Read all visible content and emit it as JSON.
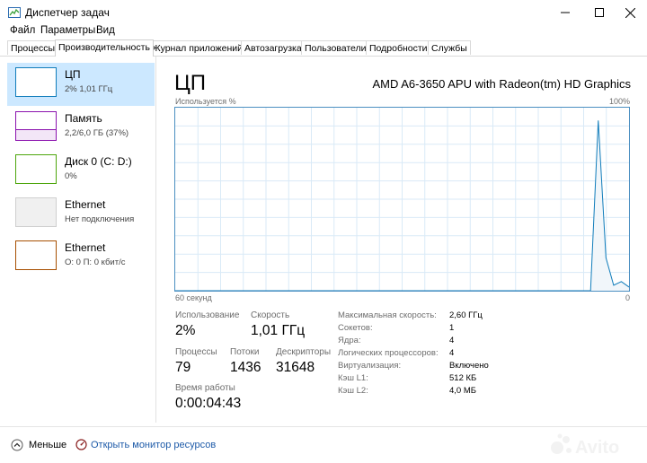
{
  "window": {
    "title": "Диспетчер задач",
    "icon": "task-manager-icon"
  },
  "menu": [
    "Файл",
    "Параметры",
    "Вид"
  ],
  "tabs": [
    "Процессы",
    "Производительность",
    "Журнал приложений",
    "Автозагрузка",
    "Пользователи",
    "Подробности",
    "Службы"
  ],
  "sidebar": {
    "items": [
      {
        "name": "ЦП",
        "value": "2% 1,01 ГГц",
        "color": "#117dbb"
      },
      {
        "name": "Память",
        "value": "2,2/6,0 ГБ (37%)",
        "color": "#8b12ae"
      },
      {
        "name": "Диск 0 (C: D:)",
        "value": "0%",
        "color": "#4da60c"
      },
      {
        "name": "Ethernet",
        "value": "Нет подключения",
        "color": "#cfcfcf"
      },
      {
        "name": "Ethernet",
        "value": "О: 0 П: 0 кбит/с",
        "color": "#a74f01"
      }
    ]
  },
  "main": {
    "title": "ЦП",
    "cpu_name": "AMD A6-3650 APU with Radeon(tm) HD Graphics",
    "graph": {
      "label_top_left": "Используется %",
      "label_top_right": "100%",
      "label_bottom_left": "60 секунд",
      "label_bottom_right": "0",
      "line_color": "#117dbb",
      "usage_history": [
        0,
        0,
        0,
        0,
        0,
        0,
        0,
        0,
        0,
        0,
        0,
        0,
        0,
        0,
        0,
        0,
        0,
        0,
        0,
        0,
        0,
        0,
        0,
        0,
        0,
        0,
        0,
        0,
        0,
        0,
        0,
        0,
        0,
        0,
        0,
        0,
        0,
        0,
        0,
        0,
        0,
        0,
        0,
        0,
        0,
        0,
        0,
        0,
        0,
        0,
        0,
        0,
        0,
        0,
        0,
        93,
        18,
        3,
        5,
        2
      ]
    },
    "stats": {
      "usage_label": "Использование",
      "usage_value": "2%",
      "speed_label": "Скорость",
      "speed_value": "1,01 ГГц",
      "processes_label": "Процессы",
      "processes_value": "79",
      "threads_label": "Потоки",
      "threads_value": "1436",
      "handles_label": "Дескрипторы",
      "handles_value": "31648",
      "uptime_label": "Время работы",
      "uptime_value": "0:00:04:43"
    },
    "details": [
      {
        "label": "Максимальная скорость:",
        "value": "2,60 ГГц"
      },
      {
        "label": "Сокетов:",
        "value": "1"
      },
      {
        "label": "Ядра:",
        "value": "4"
      },
      {
        "label": "Логических процессоров:",
        "value": "4"
      },
      {
        "label": "Виртуализация:",
        "value": "Включено"
      },
      {
        "label": "Кэш L1:",
        "value": "512 КБ"
      },
      {
        "label": "Кэш L2:",
        "value": "4,0 МБ"
      }
    ]
  },
  "footer": {
    "fewer_label": "Меньше",
    "monitor_label": "Открыть монитор ресурсов",
    "watermark": "Avito"
  }
}
